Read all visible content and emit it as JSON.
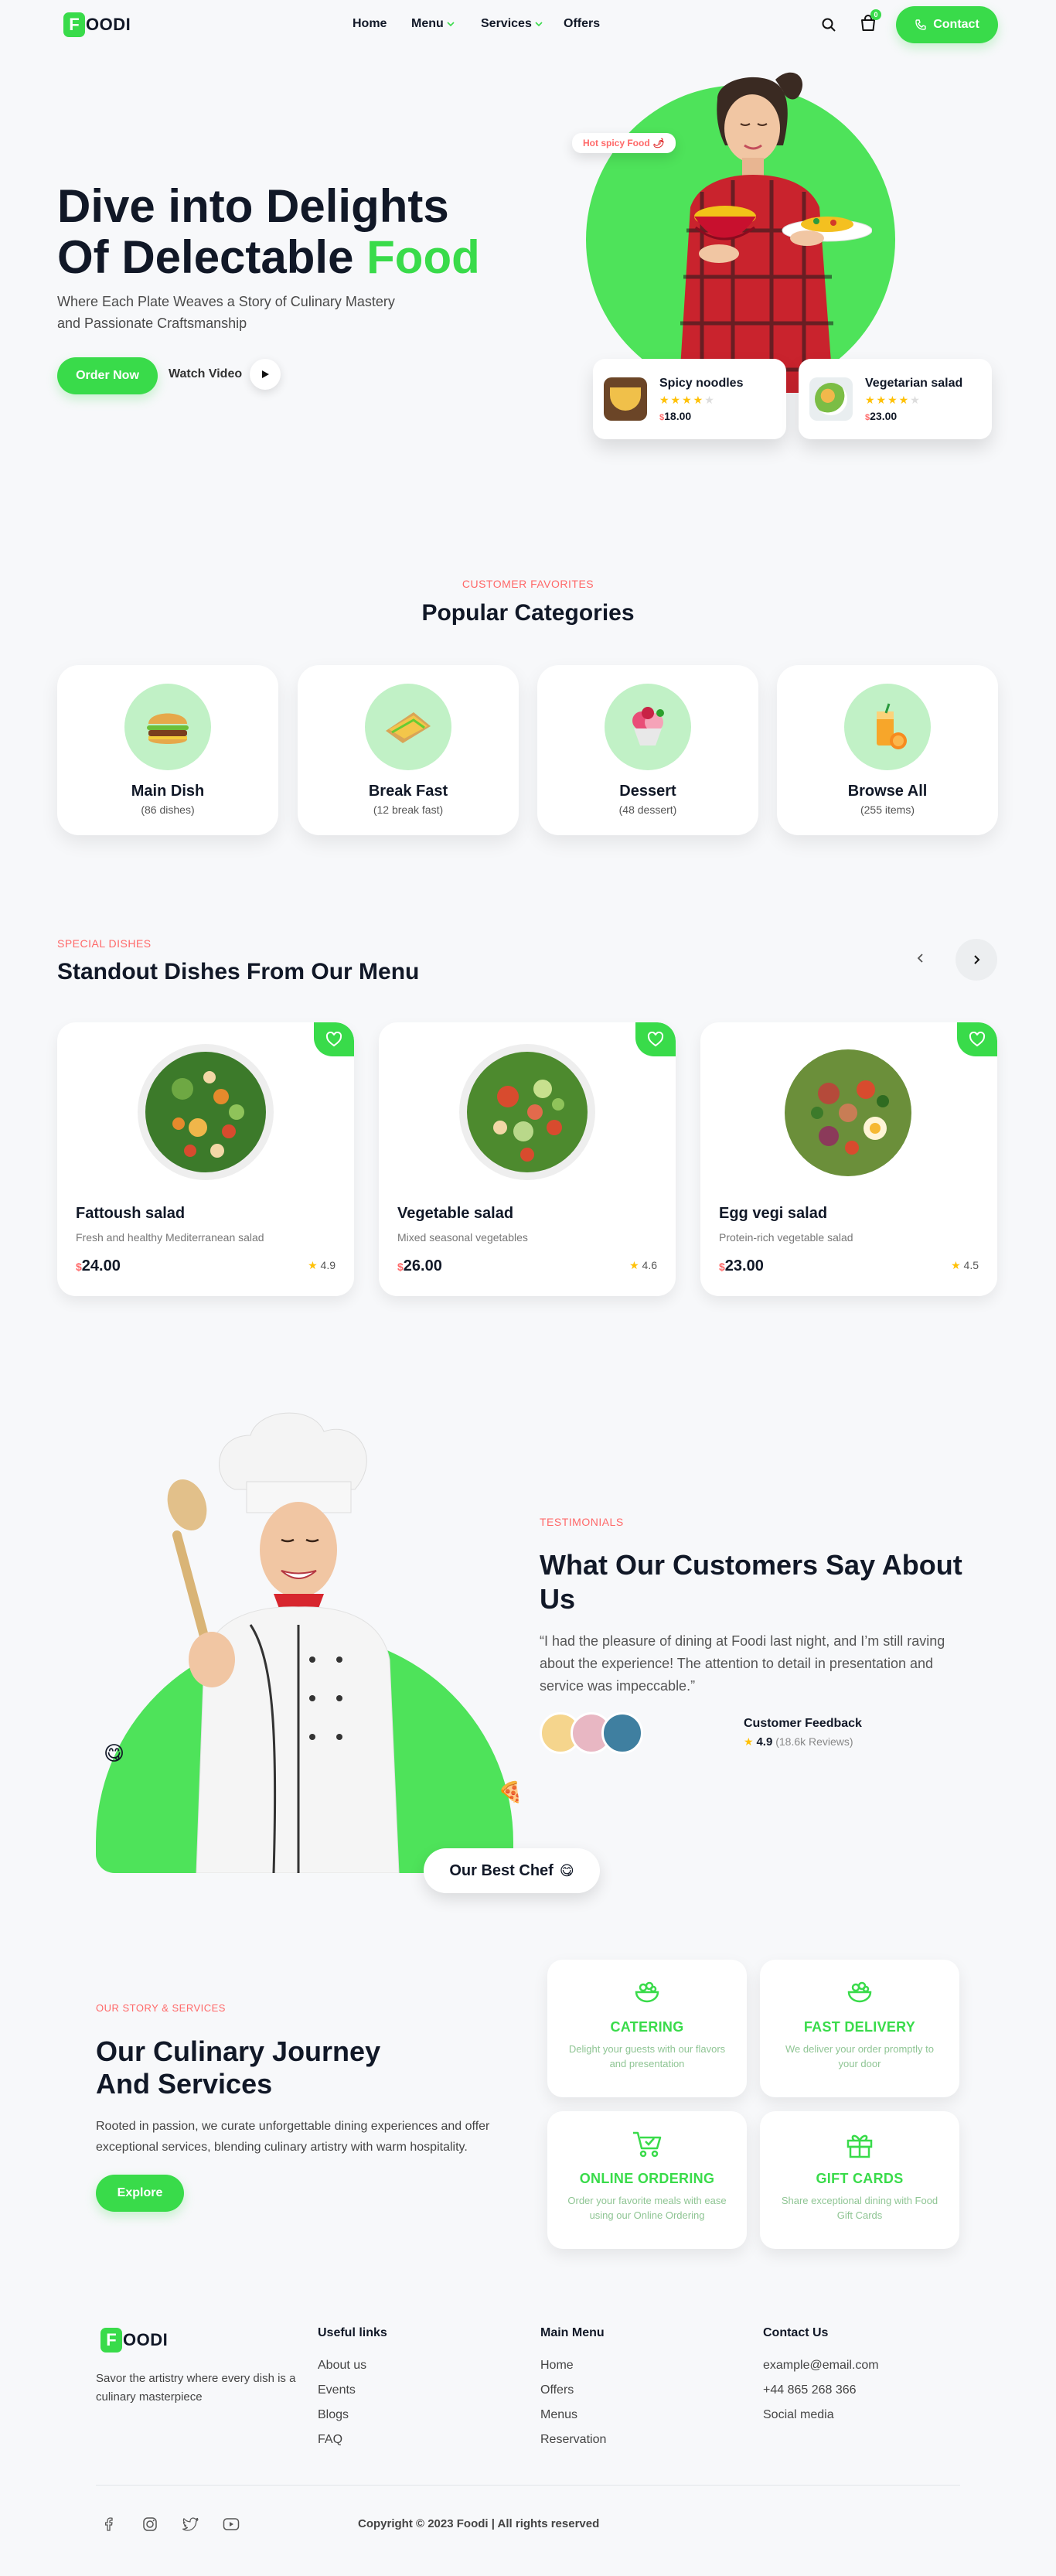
{
  "brand": {
    "badge": "F",
    "name": "OODI"
  },
  "nav": {
    "links": [
      "Home",
      "Menu",
      "Services",
      "Offers"
    ],
    "cart_count": "0",
    "contact_label": "Contact"
  },
  "hero": {
    "title_line1": "Dive into Delights",
    "title_line2_a": "Of Delectable ",
    "title_line2_b": "Food",
    "subtitle": "Where Each Plate Weaves a Story of Culinary Mastery and Passionate Craftsmanship",
    "order_button": "Order Now",
    "watch_label": "Watch Video",
    "tag": "Hot spicy Food",
    "cards": [
      {
        "name": "Spicy noodles",
        "rating": 4,
        "currency": "$",
        "price": "18.00"
      },
      {
        "name": "Vegetarian salad",
        "rating": 4,
        "currency": "$",
        "price": "23.00"
      }
    ]
  },
  "categories": {
    "label": "CUSTOMER FAVORITES",
    "title": "Popular Categories",
    "items": [
      {
        "name": "Main Dish",
        "count": "(86 dishes)",
        "icon": "burger-icon"
      },
      {
        "name": "Break Fast",
        "count": "(12 break fast)",
        "icon": "sandwich-icon"
      },
      {
        "name": "Dessert",
        "count": "(48 dessert)",
        "icon": "ice-cream-icon"
      },
      {
        "name": "Browse All",
        "count": "(255 items)",
        "icon": "juice-icon"
      }
    ]
  },
  "dishes": {
    "label": "SPECIAL DISHES",
    "title": "Standout Dishes From Our Menu",
    "items": [
      {
        "name": "Fattoush salad",
        "desc": "Fresh and healthy Mediterranean salad",
        "currency": "$",
        "price": "24.00",
        "rating": "4.9"
      },
      {
        "name": "Vegetable salad",
        "desc": "Mixed seasonal vegetables",
        "currency": "$",
        "price": "26.00",
        "rating": "4.6"
      },
      {
        "name": "Egg vegi salad",
        "desc": "Protein-rich vegetable salad",
        "currency": "$",
        "price": "23.00",
        "rating": "4.5"
      }
    ]
  },
  "testimonials": {
    "label": "TESTIMONIALS",
    "title": "What Our Customers Say About Us",
    "quote": "“I had the pleasure of dining at Foodi last night, and I’m still raving about the experience! The attention to detail in presentation and service was impeccable.”",
    "feedback_title": "Customer Feedback",
    "rating": "4.9",
    "reviews": "(18.6k Reviews)",
    "chef_label": "Our Best Chef"
  },
  "services": {
    "label": "OUR STORY & SERVICES",
    "title_line1": "Our Culinary Journey",
    "title_line2": "And Services",
    "text": "Rooted in passion, we curate unforgettable dining experiences and offer exceptional services, blending culinary artistry with warm hospitality.",
    "button": "Explore",
    "items": [
      {
        "title": "CATERING",
        "desc": "Delight your guests with our flavors and presentation",
        "icon": "catering-icon"
      },
      {
        "title": "FAST DELIVERY",
        "desc": "We deliver your order promptly to your door",
        "icon": "delivery-icon"
      },
      {
        "title": "ONLINE ORDERING",
        "desc": "Order your favorite meals with ease using our Online Ordering",
        "icon": "cart-icon"
      },
      {
        "title": "GIFT CARDS",
        "desc": "Share exceptional dining with Food Gift Cards",
        "icon": "gift-icon"
      }
    ]
  },
  "footer": {
    "tagline": "Savor the artistry where every dish is a culinary masterpiece",
    "cols": [
      {
        "head": "Useful links",
        "links": [
          "About us",
          "Events",
          "Blogs",
          "FAQ"
        ]
      },
      {
        "head": "Main Menu",
        "links": [
          "Home",
          "Offers",
          "Menus",
          "Reservation"
        ]
      },
      {
        "head": "Contact Us",
        "links": [
          "example@email.com",
          "+44 865 268 366",
          "Social media"
        ]
      }
    ],
    "copyright": "Copyright © 2023 Foodi | All rights reserved"
  }
}
